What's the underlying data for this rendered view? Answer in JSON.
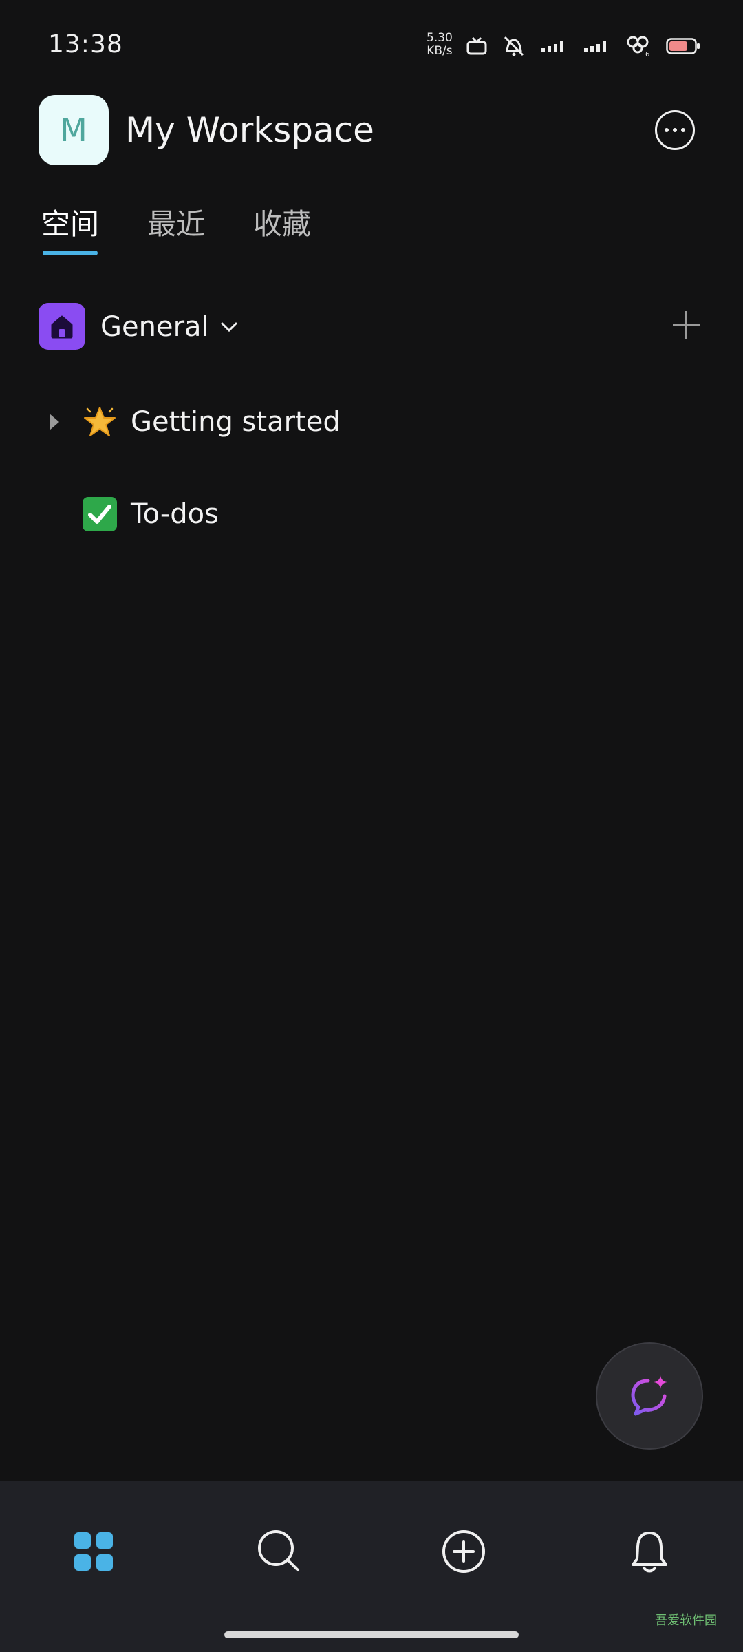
{
  "status_bar": {
    "time": "13:38",
    "net_speed_value": "5.30",
    "net_speed_unit": "KB/s",
    "battery_level": "66"
  },
  "header": {
    "avatar_letter": "M",
    "workspace_title": "My Workspace"
  },
  "tabs": [
    {
      "label": "空间",
      "active": true
    },
    {
      "label": "最近",
      "active": false
    },
    {
      "label": "收藏",
      "active": false
    }
  ],
  "space": {
    "name": "General"
  },
  "pages": [
    {
      "emoji": "star",
      "title": "Getting started",
      "expandable": true
    },
    {
      "emoji": "check",
      "title": "To-dos",
      "expandable": false
    }
  ],
  "colors": {
    "background": "#121213",
    "accent_tab": "#4ab3e6",
    "space_icon": "#8a4cf2",
    "nav_active": "#4ab3e6",
    "bottom_nav_bg": "#202126"
  },
  "bottom_nav": [
    {
      "icon": "grid-icon",
      "active": true
    },
    {
      "icon": "search-icon",
      "active": false
    },
    {
      "icon": "add-circle-icon",
      "active": false
    },
    {
      "icon": "bell-icon",
      "active": false
    }
  ],
  "watermark": "吾爱软件园"
}
